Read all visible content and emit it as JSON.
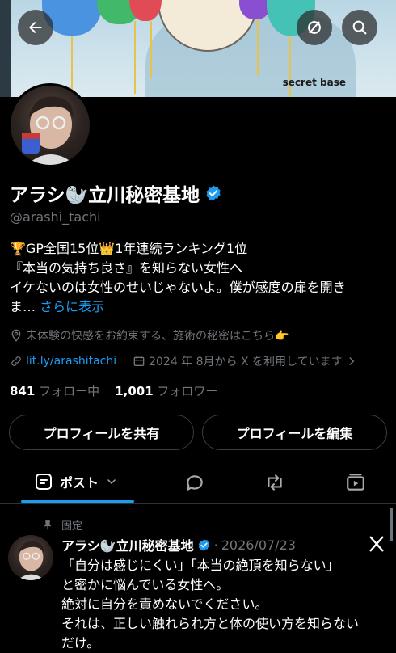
{
  "banner": {
    "text": "secret base"
  },
  "profile": {
    "name": "アラシ🦭立川秘密基地",
    "handle": "@arashi_tachi",
    "bio_lines": [
      "🏆GP全国15位👑1年連続ランキング1位",
      "『本当の気持ち良さ』を知らない女性へ",
      "イケないのは女性のせいじゃないよ。僕が感度の扉を開き"
    ],
    "bio_tail": "ま…",
    "bio_more": "さらに表示",
    "location": "未体験の快感をお約束する、施術の秘密はこちら👉",
    "link": "lit.ly/arashitachi",
    "joined": "2024 年 8月から X を利用しています",
    "following_count": "841",
    "following_label": "フォロー中",
    "followers_count": "1,001",
    "followers_label": "フォロワー"
  },
  "buttons": {
    "share": "プロフィールを共有",
    "edit": "プロフィールを編集"
  },
  "tabs": {
    "posts": "ポスト"
  },
  "pinned_post": {
    "pinned_label": "固定",
    "author": "アラシ🦭立川秘密基地",
    "separator": "·",
    "date": "2026/07/23",
    "lines": [
      "「自分は感じにくい」「本当の絶頂を知らない」",
      "と密かに悩んでいる女性へ。",
      "絶対に自分を責めないでください。",
      "それは、正しい触れられ方と体の使い方を知らない",
      "だけ。"
    ]
  },
  "colors": {
    "accent": "#1d9bf0",
    "verified": "#1d9bf0",
    "background": "#000000"
  },
  "icons": [
    "back-arrow-icon",
    "no-signal-icon",
    "search-icon",
    "verified-badge-icon",
    "location-icon",
    "link-icon",
    "calendar-icon",
    "chevron-right-icon",
    "post-list-icon",
    "chevron-down-icon",
    "reply-bubble-icon",
    "repost-icon",
    "media-icon",
    "pin-icon",
    "x-logo-icon"
  ]
}
